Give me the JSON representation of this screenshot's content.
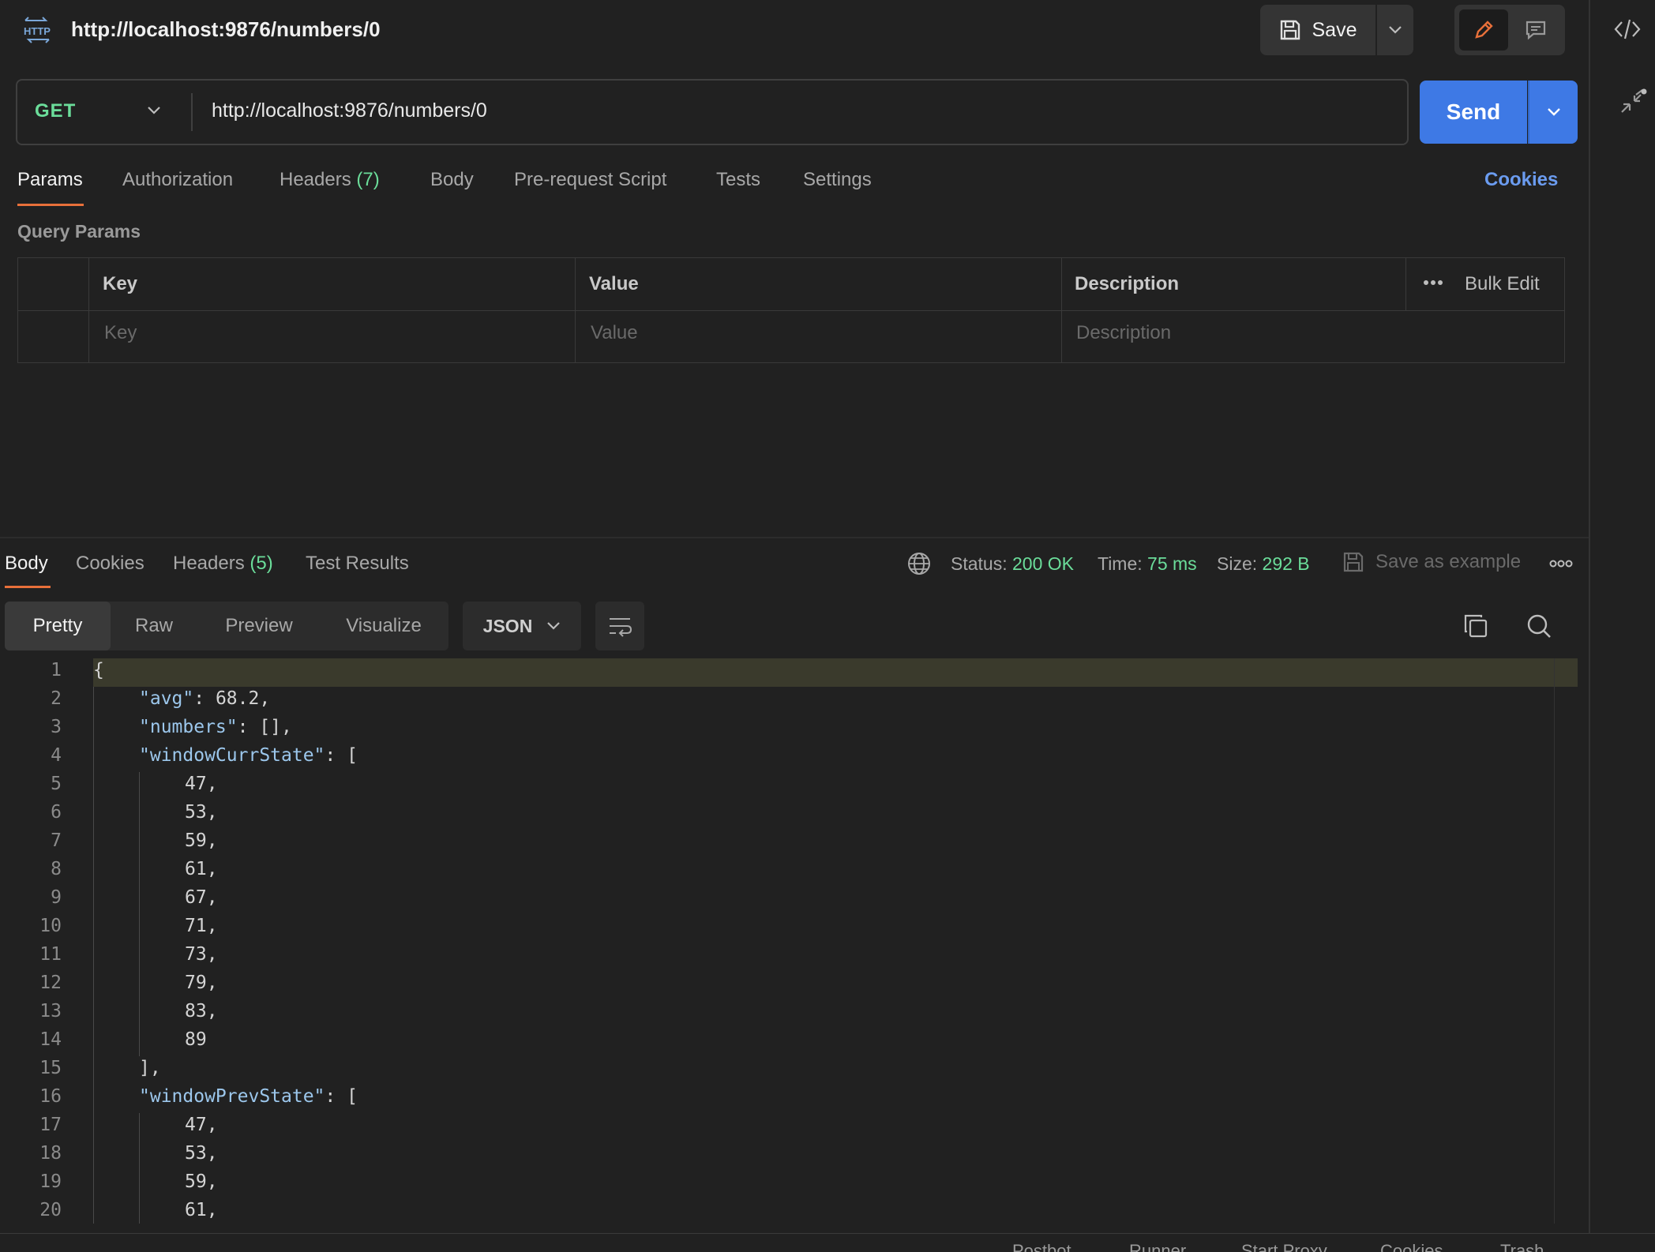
{
  "header": {
    "title": "http://localhost:9876/numbers/0",
    "save_label": "Save"
  },
  "request": {
    "method": "GET",
    "url": "http://localhost:9876/numbers/0",
    "send_label": "Send",
    "tabs": [
      {
        "label": "Params"
      },
      {
        "label": "Authorization"
      },
      {
        "label": "Headers",
        "count": "(7)"
      },
      {
        "label": "Body"
      },
      {
        "label": "Pre-request Script"
      },
      {
        "label": "Tests"
      },
      {
        "label": "Settings"
      }
    ],
    "cookies_label": "Cookies",
    "query_params_title": "Query Params",
    "table": {
      "headers": [
        "Key",
        "Value",
        "Description"
      ],
      "bulk_edit": "Bulk Edit",
      "placeholders": [
        "Key",
        "Value",
        "Description"
      ]
    }
  },
  "response": {
    "tabs": [
      {
        "label": "Body"
      },
      {
        "label": "Cookies"
      },
      {
        "label": "Headers",
        "count": "(5)"
      },
      {
        "label": "Test Results"
      }
    ],
    "status_label": "Status:",
    "status_value": "200 OK",
    "time_label": "Time:",
    "time_value": "75 ms",
    "size_label": "Size:",
    "size_value": "292 B",
    "save_example": "Save as example",
    "formats": [
      "Pretty",
      "Raw",
      "Preview",
      "Visualize"
    ],
    "language": "JSON",
    "code_lines": [
      {
        "n": "1",
        "t": "{"
      },
      {
        "n": "2",
        "k": "\"avg\"",
        "t": ": 68.2,"
      },
      {
        "n": "3",
        "k": "\"numbers\"",
        "t": ": [],"
      },
      {
        "n": "4",
        "k": "\"windowCurrState\"",
        "t": ": ["
      },
      {
        "n": "5",
        "t": "47,",
        "i": 2
      },
      {
        "n": "6",
        "t": "53,",
        "i": 2
      },
      {
        "n": "7",
        "t": "59,",
        "i": 2
      },
      {
        "n": "8",
        "t": "61,",
        "i": 2
      },
      {
        "n": "9",
        "t": "67,",
        "i": 2
      },
      {
        "n": "10",
        "t": "71,",
        "i": 2
      },
      {
        "n": "11",
        "t": "73,",
        "i": 2
      },
      {
        "n": "12",
        "t": "79,",
        "i": 2
      },
      {
        "n": "13",
        "t": "83,",
        "i": 2
      },
      {
        "n": "14",
        "t": "89",
        "i": 2
      },
      {
        "n": "15",
        "t": "],",
        "i": 1
      },
      {
        "n": "16",
        "k": "\"windowPrevState\"",
        "t": ": ["
      },
      {
        "n": "17",
        "t": "47,",
        "i": 2
      },
      {
        "n": "18",
        "t": "53,",
        "i": 2
      },
      {
        "n": "19",
        "t": "59,",
        "i": 2
      },
      {
        "n": "20",
        "t": "61,",
        "i": 2
      }
    ]
  },
  "footer": {
    "items": [
      "Postbot",
      "Runner",
      "Start Proxy",
      "Cookies",
      "Trash"
    ]
  },
  "colors": {
    "accent": "#e8703a",
    "send": "#3e79e5",
    "success": "#6bdd9a",
    "link": "#6b9cf0"
  }
}
